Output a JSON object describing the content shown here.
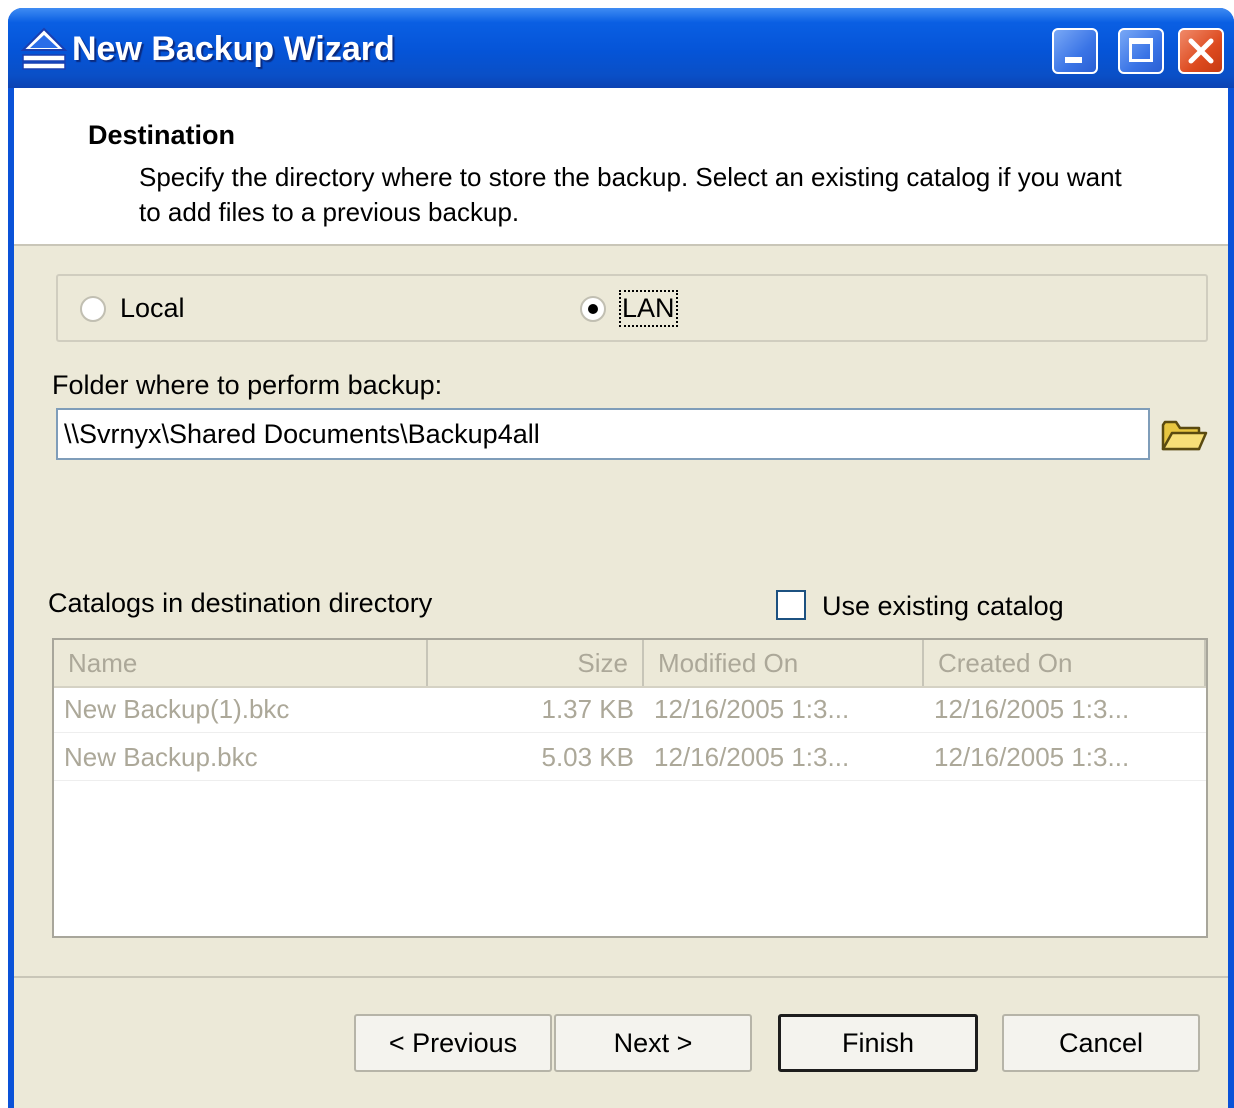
{
  "window": {
    "title": "New Backup Wizard"
  },
  "header": {
    "title": "Destination",
    "description": "Specify the directory where to store the backup. Select an existing catalog if you want to add files to a previous backup."
  },
  "location": {
    "options": [
      {
        "label": "Local",
        "selected": false
      },
      {
        "label": "LAN",
        "selected": true
      }
    ]
  },
  "folder": {
    "label": "Folder where to perform backup:",
    "value": "\\\\Svrnyx\\Shared Documents\\Backup4all"
  },
  "catalogs": {
    "label": "Catalogs in destination directory",
    "use_existing_label": "Use existing catalog",
    "use_existing_checked": false,
    "columns": [
      "Name",
      "Size",
      "Modified On",
      "Created On"
    ],
    "rows": [
      {
        "name": "New Backup(1).bkc",
        "size": "1.37 KB",
        "modified": "12/16/2005 1:3...",
        "created": "12/16/2005 1:3..."
      },
      {
        "name": "New Backup.bkc",
        "size": "5.03 KB",
        "modified": "12/16/2005 1:3...",
        "created": "12/16/2005 1:3..."
      }
    ]
  },
  "buttons": {
    "previous": "< Previous",
    "next": "Next >",
    "finish": "Finish",
    "cancel": "Cancel"
  },
  "icons": {
    "app": "backup-icon",
    "minimize": "minimize-icon",
    "maximize": "maximize-icon",
    "close": "close-icon",
    "browse": "folder-icon"
  },
  "colors": {
    "titlebar": "#0554d7",
    "dialog_bg": "#ece9d8",
    "close_button": "#dd4a1f"
  }
}
